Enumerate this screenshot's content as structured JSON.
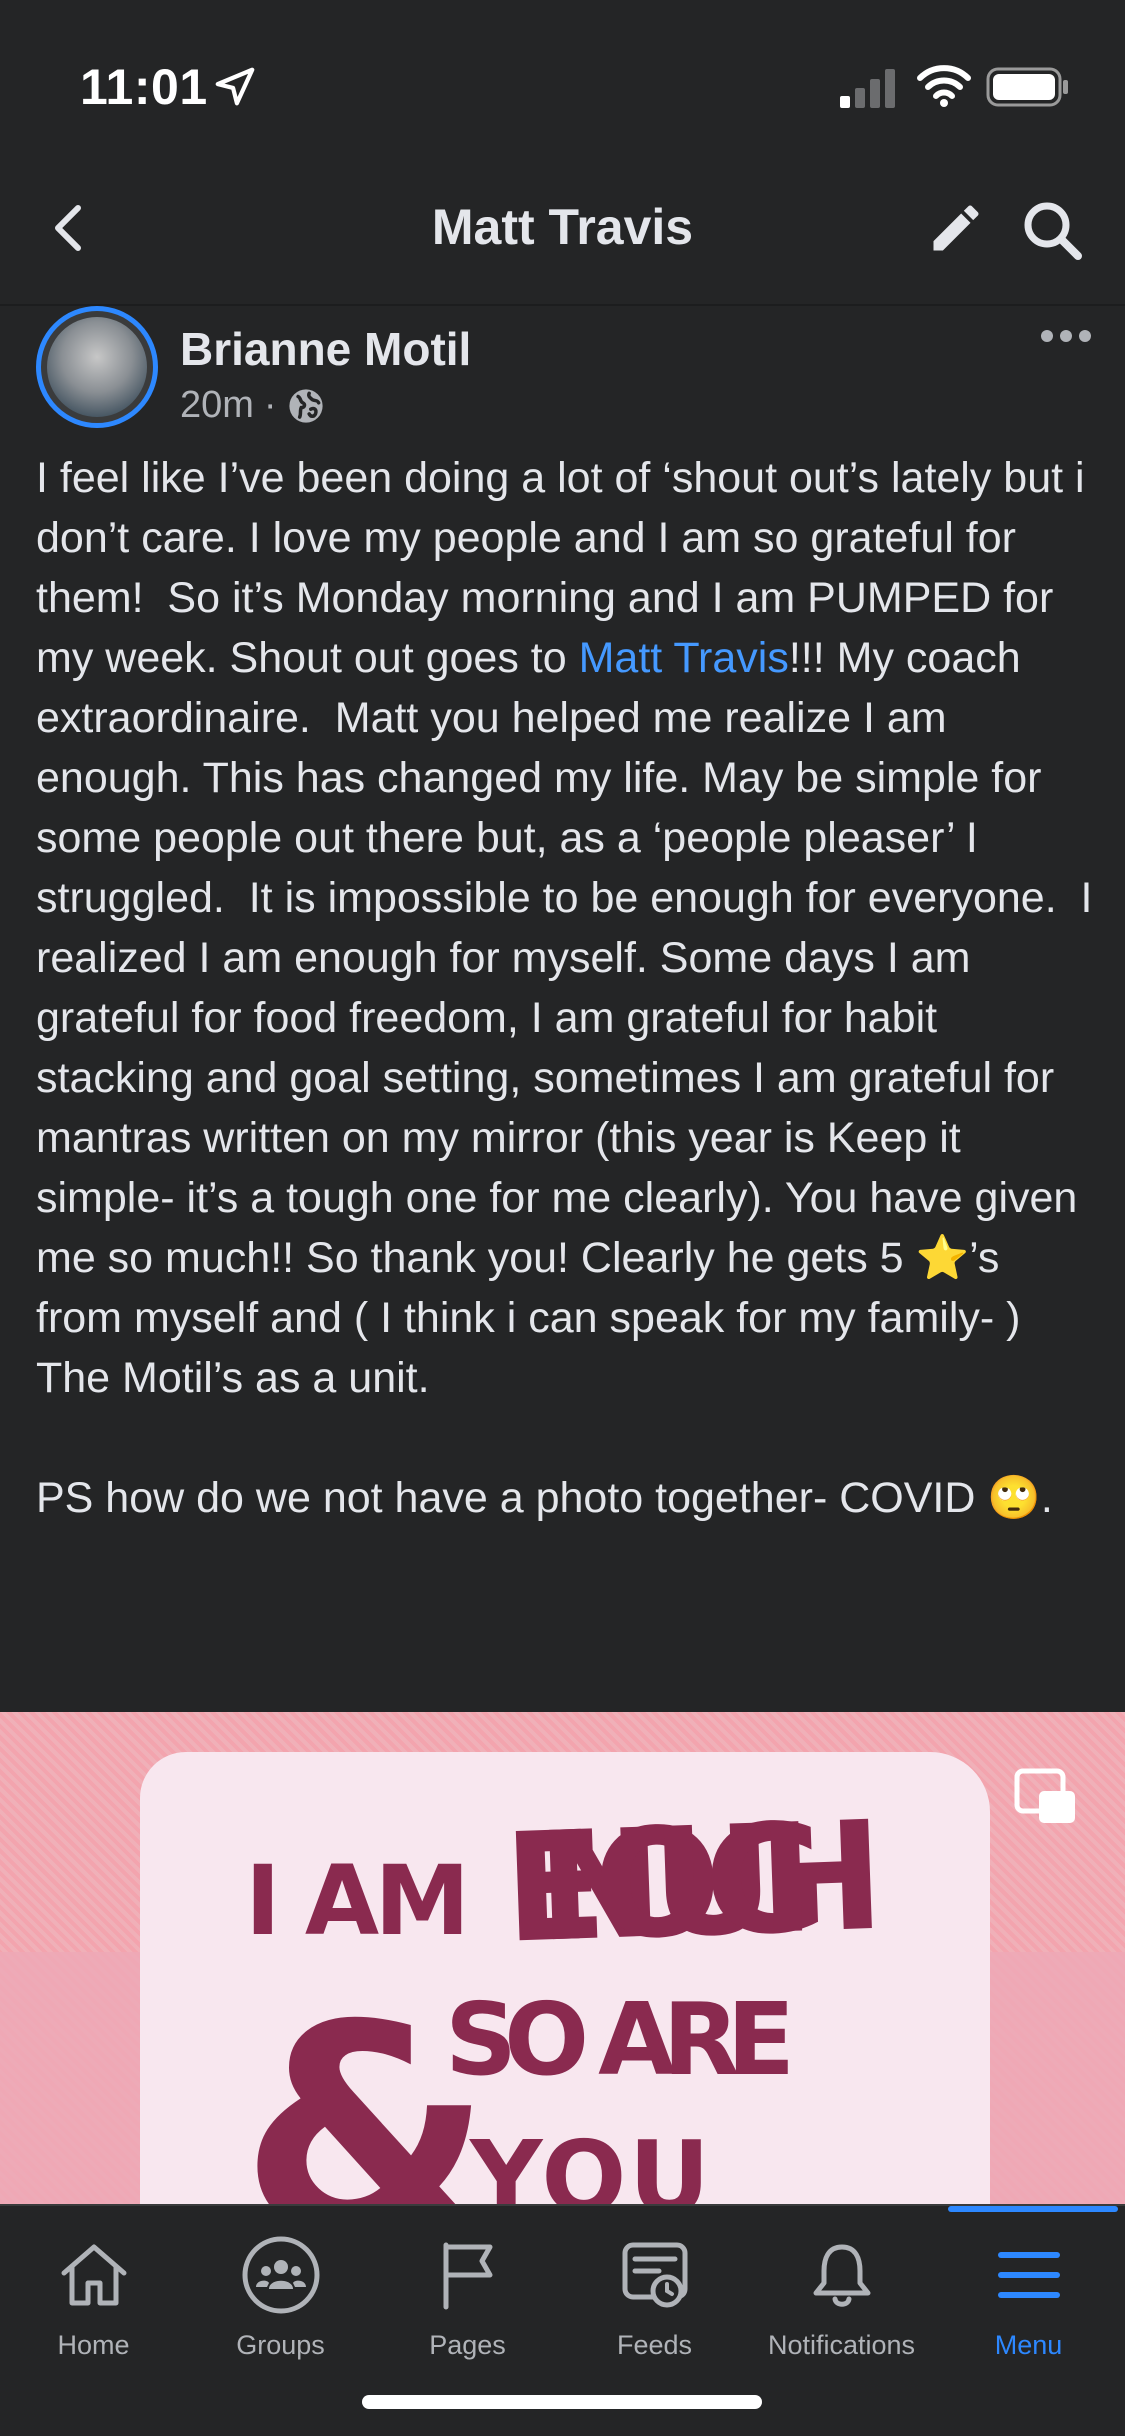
{
  "status_bar": {
    "time": "11:01",
    "icons": [
      "location-arrow-icon",
      "signal-icon",
      "wifi-icon",
      "battery-icon"
    ]
  },
  "header": {
    "title": "Matt Travis",
    "icons": [
      "back-chevron-icon",
      "edit-pencil-icon",
      "search-icon"
    ]
  },
  "post": {
    "author": "Brianne Motil",
    "time": "20m",
    "separator": "·",
    "privacy_icon": "globe-icon",
    "text_before_mention": "I feel like I’ve been doing a lot of ‘shout out’s lately but i don’t care. I love my people and I am so grateful for them!  So it’s Monday morning and I am PUMPED for my week. Shout out goes to ",
    "mention": "Matt Travis",
    "text_after_mention": "!!! My coach extraordinaire.  Matt you helped me realize I am enough. This has changed my life. May be simple for some people out there but, as a ‘people pleaser’ I struggled.  It is impossible to be enough for everyone.  I realized I am enough for myself. Some days I am grateful for food freedom, I am grateful for habit stacking and goal setting, sometimes I am grateful for mantras written on my mirror (this year is Keep it simple- it’s a tough one for me clearly). You have given me so much!! So thank you! Clearly he gets 5 ⭐’s from myself and ( I think i can speak for my family- ) The Motil’s as a unit.\n\nPS how do we not have a photo together- COVID 🙄.",
    "image_text": {
      "line1a": "I AM",
      "line1b": "ENOUGH",
      "amp": "&",
      "line2": "SO ARE",
      "line3": "YOU"
    }
  },
  "tab_bar": {
    "active": "Menu",
    "accent_color": "#2d88ff",
    "tabs": [
      {
        "label": "Home",
        "icon": "home-icon"
      },
      {
        "label": "Groups",
        "icon": "groups-icon"
      },
      {
        "label": "Pages",
        "icon": "flag-icon"
      },
      {
        "label": "Feeds",
        "icon": "feeds-icon"
      },
      {
        "label": "Notifications",
        "icon": "bell-icon"
      },
      {
        "label": "Menu",
        "icon": "hamburger-menu-icon"
      }
    ]
  }
}
